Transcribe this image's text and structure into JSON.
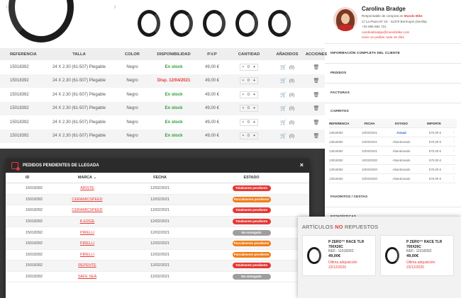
{
  "customer": {
    "name": "Carolina Bradge",
    "lines": [
      {
        "label": "Responsable de compras en ",
        "extra": "Mundo Bike"
      },
      {
        "label": "C/ La Plaza Nº 23 · 41370 Bormujos (Sevilla)"
      },
      {
        "label": "+34 655 884 721"
      },
      {
        "label": "carolinabradge@mundobike.com",
        "red": true
      },
      {
        "label": "Hace un pedido cada 15 días",
        "red": true
      }
    ],
    "sections": [
      "INFORMACIÓN COMPLETA DEL CLIENTE",
      "PEDIDOS",
      "FACTURAS",
      "CARRITOS"
    ],
    "carts": {
      "headers": [
        "REFERENCIA",
        "FECHA",
        "ESTADO",
        "IMPORTE"
      ],
      "rows": [
        [
          "13018392",
          "10/03/2021",
          "Actual",
          "570,00 €"
        ],
        [
          "13018392",
          "10/03/2021",
          "Abandonado",
          "570,00 €"
        ],
        [
          "13018392",
          "10/03/2021",
          "Abandonado",
          "570,00 €"
        ],
        [
          "13018392",
          "10/03/2020",
          "Abandonado",
          "570,00 €"
        ],
        [
          "13018392",
          "10/03/2020",
          "Abandonado",
          "570,00 €"
        ],
        [
          "13018392",
          "10/03/2020",
          "Abandonado",
          "570,00 €"
        ]
      ]
    },
    "bottom_sections": [
      "FAVORITOS / CESTAS",
      "ESTADÍSTICAS"
    ]
  },
  "products": {
    "headers": [
      "REFERENCIA",
      "TALLA",
      "COLOR",
      "DISPONIBILIDAD",
      "P.V.P",
      "CANTIDAD",
      "AÑADIDOS",
      "ACCIONES"
    ],
    "rows": [
      {
        "ref": "15018392",
        "size": "24 X 2.30 (61-507) Plegable",
        "color": "Negro",
        "avail": "En stock",
        "avail_type": "green",
        "price": "49,00 €",
        "qty": "0",
        "added": "(0)"
      },
      {
        "ref": "15018392",
        "size": "24 X 2.30 (61-507) Plegable",
        "color": "Negro",
        "avail": "Disp. 12/04/2021",
        "avail_type": "red",
        "price": "49,00 €",
        "qty": "0",
        "added": "(0)"
      },
      {
        "ref": "15018392",
        "size": "24 X 2.30 (61-507) Plegable",
        "color": "Negro",
        "avail": "En stock",
        "avail_type": "green",
        "price": "49,00 €",
        "qty": "0",
        "added": "(0)"
      },
      {
        "ref": "15018392",
        "size": "24 X 2.30 (61-507) Plegable",
        "color": "Negro",
        "avail": "En stock",
        "avail_type": "green",
        "price": "49,00 €",
        "qty": "0",
        "added": "(0)"
      },
      {
        "ref": "15018392",
        "size": "24 X 2.30 (61-507) Plegable",
        "color": "Negro",
        "avail": "En stock",
        "avail_type": "green",
        "price": "49,00 €",
        "qty": "0",
        "added": "(0)"
      },
      {
        "ref": "15018392",
        "size": "24 X 2.30 (61-507) Plegable",
        "color": "Negro",
        "avail": "En stock",
        "avail_type": "green",
        "price": "49,00 €",
        "qty": "0",
        "added": "(0)"
      }
    ]
  },
  "pending": {
    "title": "PEDIDOS PENDIENTES DE LLEGADA",
    "headers": [
      "ID",
      "MARCA",
      "FECHA",
      "ESTADO"
    ],
    "rows": [
      {
        "id": "15018392",
        "brand": "ARISTE",
        "date": "12/02/2021",
        "status": "Totalmente pendiente",
        "kind": "red"
      },
      {
        "id": "15018392",
        "brand": "CERAMICSPEED",
        "date": "12/02/2021",
        "status": "Parcialmente pendiente",
        "kind": "orange"
      },
      {
        "id": "15018392",
        "brand": "CERAMICSPEED",
        "date": "12/02/2021",
        "status": "Totalmente pendiente",
        "kind": "red"
      },
      {
        "id": "15018392",
        "brand": "K-EDGE",
        "date": "12/02/2021",
        "status": "Totalmente pendiente",
        "kind": "red"
      },
      {
        "id": "15018392",
        "brand": "PIRELLI",
        "date": "12/02/2021",
        "status": "No entregado",
        "kind": "grey"
      },
      {
        "id": "15018392",
        "brand": "PIRELLI",
        "date": "12/02/2021",
        "status": "Parcialmente pendiente",
        "kind": "orange"
      },
      {
        "id": "15018392",
        "brand": "PIRELLI",
        "date": "12/02/2021",
        "status": "Parcialmente pendiente",
        "kind": "orange"
      },
      {
        "id": "15018392",
        "brand": "REPENTE",
        "date": "12/02/2021",
        "status": "Totalmente pendiente",
        "kind": "red"
      },
      {
        "id": "15018392",
        "brand": "SAFE SEA",
        "date": "12/02/2021",
        "status": "No entregado",
        "kind": "grey"
      }
    ]
  },
  "not_restocked": {
    "title_prefix": "ARTÍCULOS ",
    "title_highlight": "NO",
    "title_suffix": " REPUESTOS",
    "cards": [
      {
        "name": "P ZERO™ RACE TLR",
        "size": "700X26C",
        "ref": "REF.: 11018392",
        "price": "49,00€",
        "last_label": "Última adquisición",
        "last_date": "23/12/2020"
      },
      {
        "name": "P ZERO™ RACE TLR",
        "size": "700X26C",
        "ref": "REF.: 11018392",
        "price": "49,00€",
        "last_label": "Última adquisición",
        "last_date": "23/12/2020"
      }
    ]
  }
}
